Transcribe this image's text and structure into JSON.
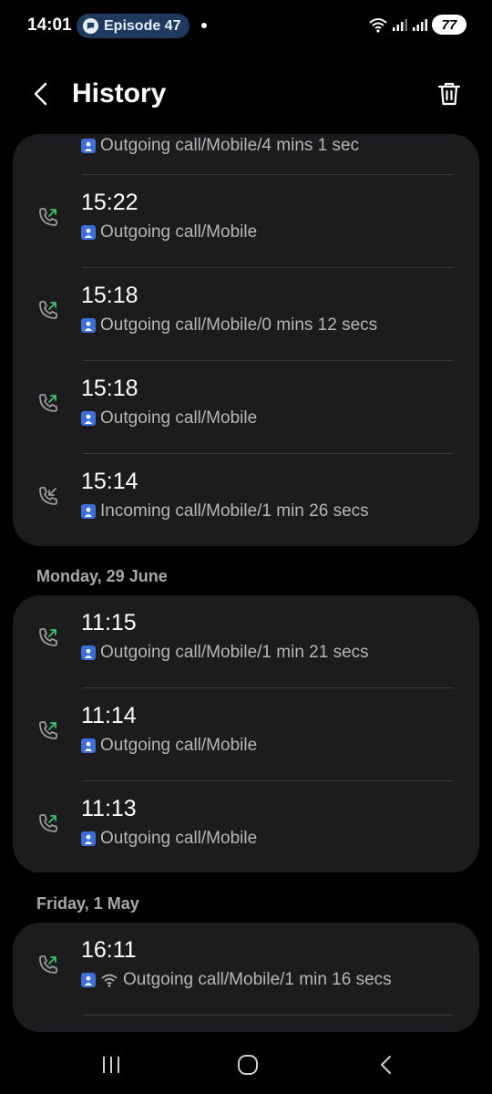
{
  "status_bar": {
    "time": "14:01",
    "notification_pill": "Episode 47",
    "battery": "77"
  },
  "app_bar": {
    "title": "History"
  },
  "colors": {
    "outgoing_arrow": "#3ec46d",
    "incoming_arrow": "#9a9a9e",
    "card_bg": "#1c1c1e",
    "contact_badge": "#3d6fd8"
  },
  "groups": [
    {
      "header": "",
      "rows": [
        {
          "time": "",
          "detail": "Outgoing call/Mobile/4 mins 1 sec",
          "direction": "outgoing"
        },
        {
          "time": "15:22",
          "detail": "Outgoing call/Mobile",
          "direction": "outgoing"
        },
        {
          "time": "15:18",
          "detail": "Outgoing call/Mobile/0 mins 12 secs",
          "direction": "outgoing"
        },
        {
          "time": "15:18",
          "detail": "Outgoing call/Mobile",
          "direction": "outgoing"
        },
        {
          "time": "15:14",
          "detail": "Incoming call/Mobile/1 min 26 secs",
          "direction": "incoming"
        }
      ]
    },
    {
      "header": "Monday, 29 June",
      "rows": [
        {
          "time": "11:15",
          "detail": "Outgoing call/Mobile/1 min 21 secs",
          "direction": "outgoing"
        },
        {
          "time": "11:14",
          "detail": "Outgoing call/Mobile",
          "direction": "outgoing"
        },
        {
          "time": "11:13",
          "detail": "Outgoing call/Mobile",
          "direction": "outgoing"
        }
      ]
    },
    {
      "header": "Friday, 1 May",
      "rows": [
        {
          "time": "16:11",
          "detail": "Outgoing call/Mobile/1 min 16 secs",
          "direction": "outgoing",
          "wifi": true
        }
      ]
    }
  ]
}
